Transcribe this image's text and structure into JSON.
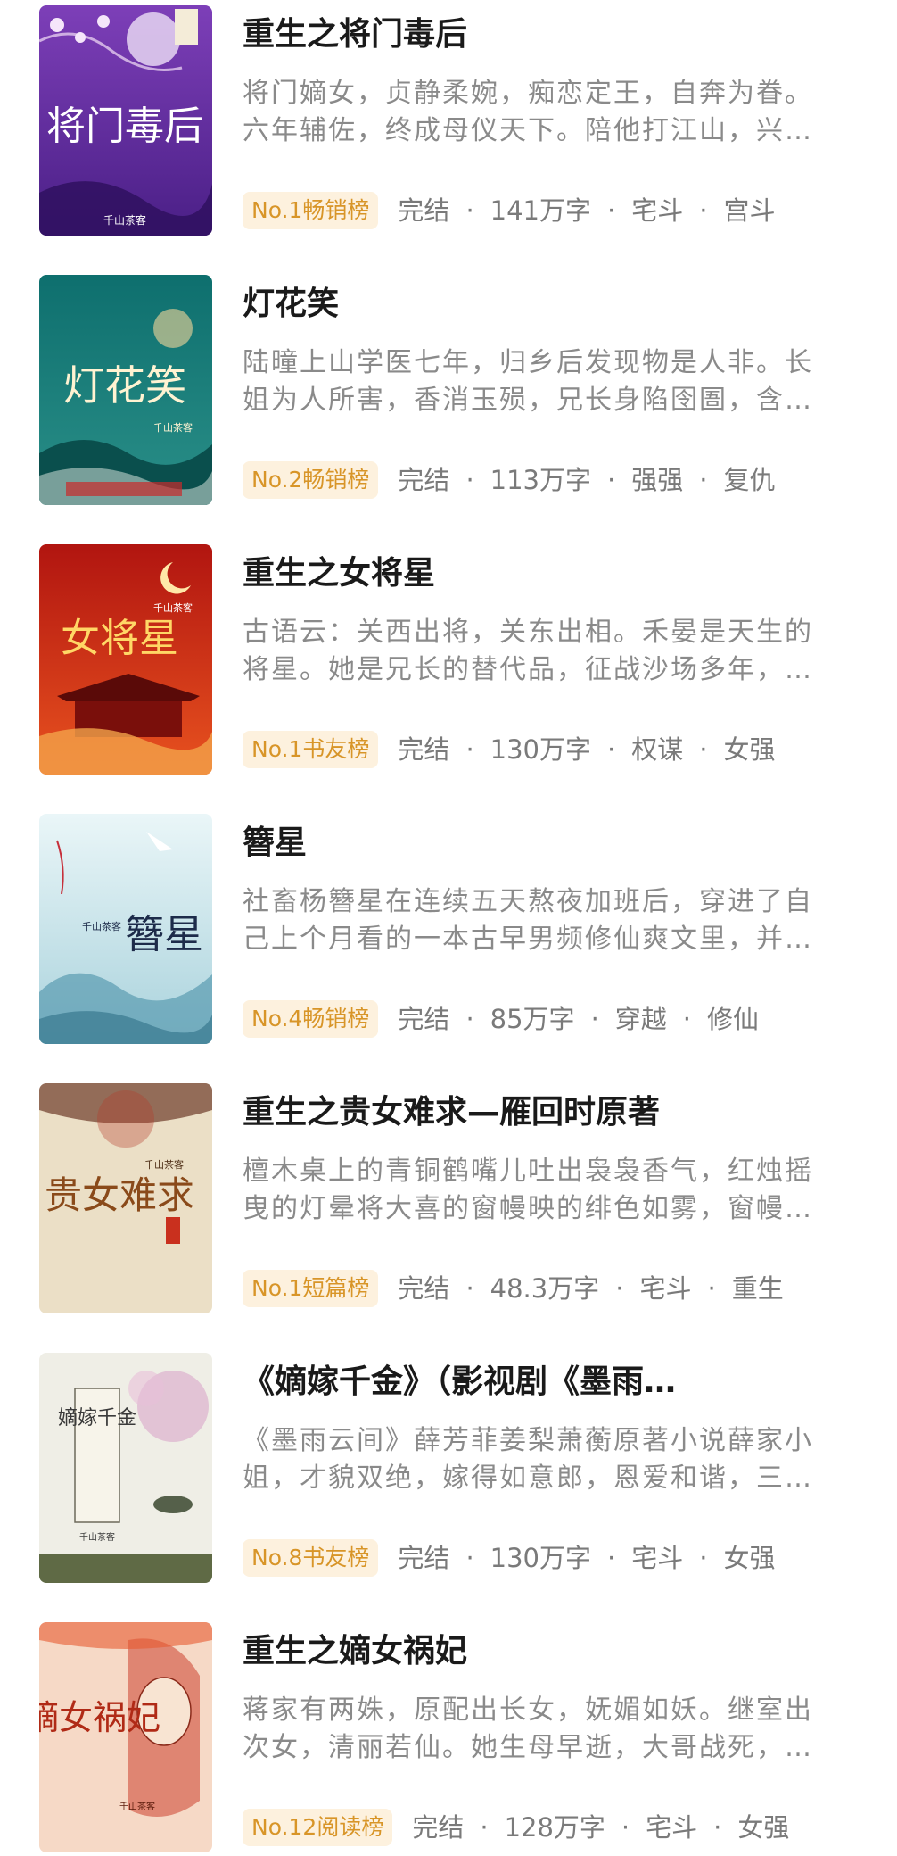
{
  "books": [
    {
      "title": "重生之将门毒后",
      "description": "将门嫡女，贞静柔婉，痴恋定王，自奔为眷。六年辅佐，终成母仪天下。陪他打江山，兴…",
      "rank": "No.1畅销榜",
      "status": "完结",
      "word_count": "141万字",
      "tags": [
        "宅斗",
        "宫斗"
      ],
      "cover": {
        "title_art": "将门毒后",
        "author": "千山茶客",
        "palette": [
          "#5a2b9a",
          "#c69bd9"
        ]
      }
    },
    {
      "title": "灯花笑",
      "description": "陆曈上山学医七年，归乡后发现物是人非。长姐为人所害，香消玉殒，兄长身陷囹圄，含…",
      "rank": "No.2畅销榜",
      "status": "完结",
      "word_count": "113万字",
      "tags": [
        "强强",
        "复仇"
      ],
      "cover": {
        "title_art": "灯花笑",
        "author": "千山茶客",
        "palette": [
          "#0f6b6b",
          "#4fb4a4"
        ]
      }
    },
    {
      "title": "重生之女将星",
      "description": "古语云：关西出将，关东出相。禾晏是天生的将星。她是兄长的替代品，征战沙场多年，…",
      "rank": "No.1书友榜",
      "status": "完结",
      "word_count": "130万字",
      "tags": [
        "权谋",
        "女强"
      ],
      "cover": {
        "title_art": "女将星",
        "author": "千山茶客",
        "palette": [
          "#a8140f",
          "#f0642a"
        ]
      }
    },
    {
      "title": "簪星",
      "description": "社畜杨簪星在连续五天熬夜加班后，穿进了自己上个月看的一本古早男频修仙爽文里，并…",
      "rank": "No.4畅销榜",
      "status": "完结",
      "word_count": "85万字",
      "tags": [
        "穿越",
        "修仙"
      ],
      "cover": {
        "title_art": "簪星",
        "author": "千山茶客",
        "palette": [
          "#bfe0e8",
          "#5f9bb0"
        ]
      }
    },
    {
      "title": "重生之贵女难求—雁回时原著",
      "description": "檀木桌上的青铜鹤嘴儿吐出袅袅香气，红烛摇曳的灯晕将大喜的窗幔映的绯色如雾，窗幔…",
      "rank": "No.1短篇榜",
      "status": "完结",
      "word_count": "48.3万字",
      "tags": [
        "宅斗",
        "重生"
      ],
      "cover": {
        "title_art": "贵女难求",
        "author": "千山茶客",
        "palette": [
          "#e9dcc4",
          "#b3875a"
        ]
      }
    },
    {
      "title": "《嫡嫁千金》（影视剧《墨雨…",
      "description": "《墨雨云间》薛芳菲姜梨萧蘅原著小说薛家小姐，才貌双绝，嫁得如意郎，恩爱和谐，三…",
      "rank": "No.8书友榜",
      "status": "完结",
      "word_count": "130万字",
      "tags": [
        "宅斗",
        "女强"
      ],
      "cover": {
        "title_art": "嫡嫁千金",
        "author": "千山茶客",
        "palette": [
          "#ecebe2",
          "#6f7a52"
        ]
      }
    },
    {
      "title": "重生之嫡女祸妃",
      "description": "蒋家有两姝，原配出长女，妩媚如妖。继室出次女，清丽若仙。她生母早逝，大哥战死，…",
      "rank": "No.12阅读榜",
      "status": "完结",
      "word_count": "128万字",
      "tags": [
        "宅斗",
        "女强"
      ],
      "cover": {
        "title_art": "嫡女祸妃",
        "author": "千山茶客",
        "palette": [
          "#f7d6c2",
          "#c8321e"
        ]
      }
    }
  ]
}
